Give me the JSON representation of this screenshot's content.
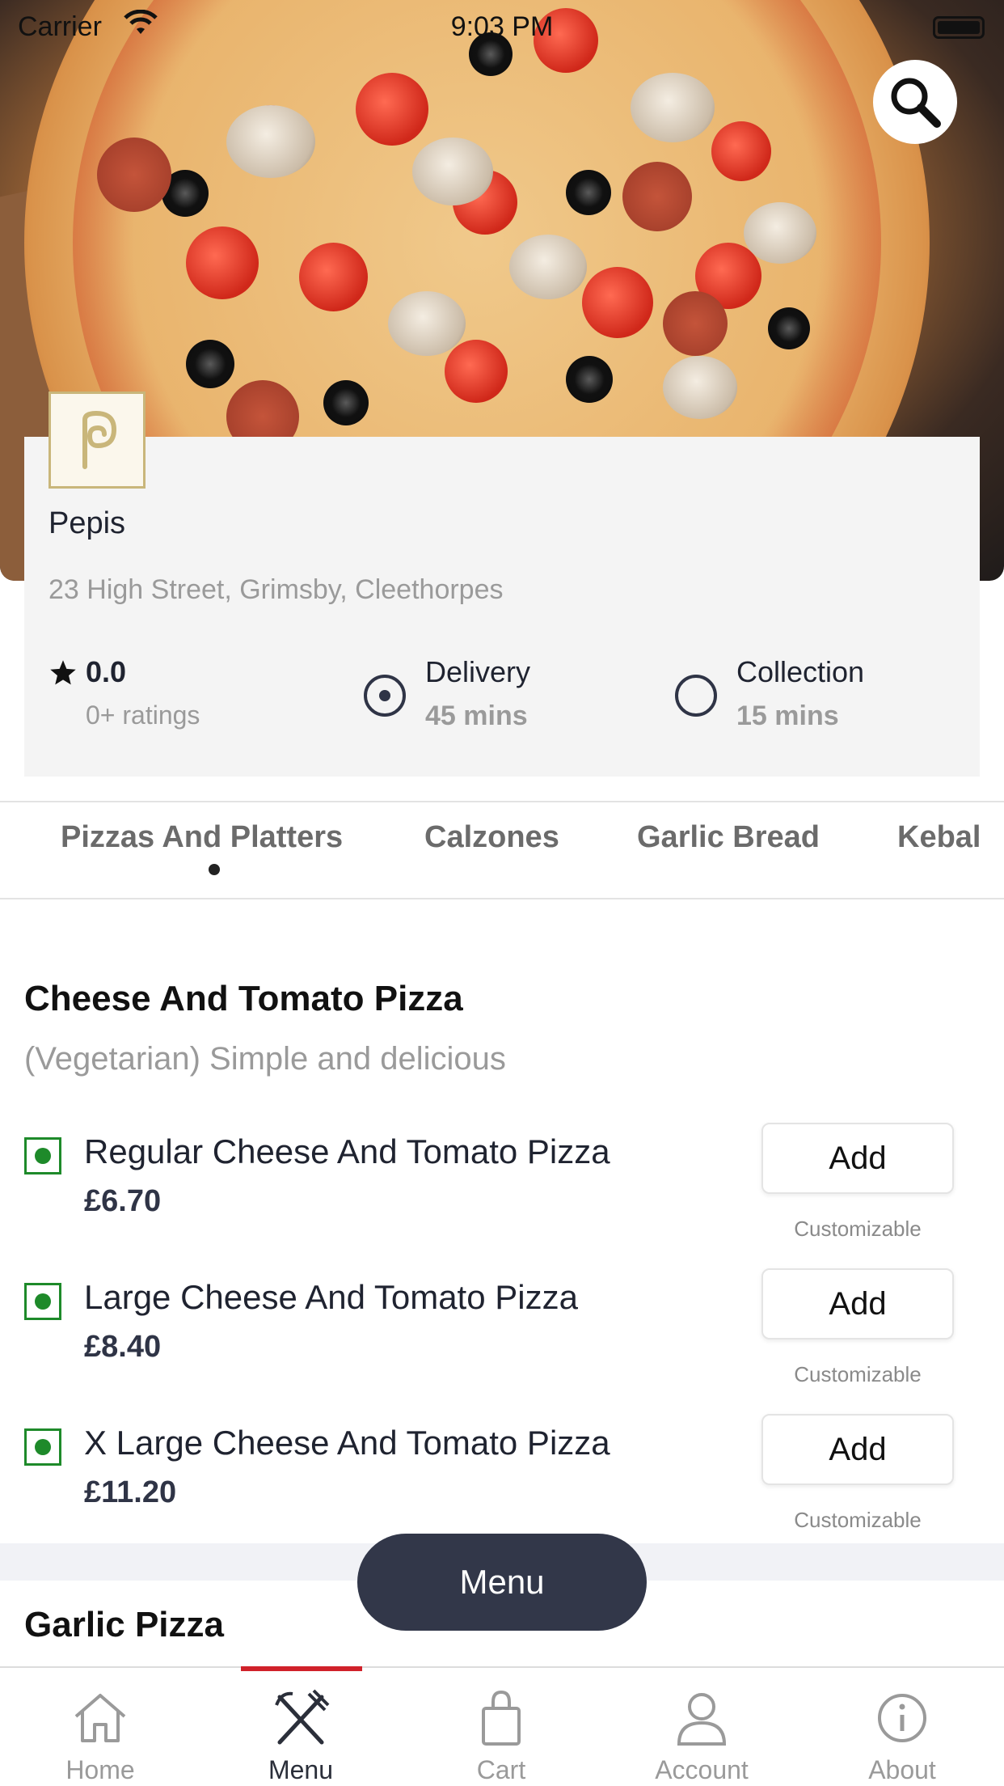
{
  "status_bar": {
    "carrier": "Carrier",
    "time": "9:03 PM"
  },
  "restaurant": {
    "name": "Pepis",
    "address": "23 High Street, Grimsby, Cleethorpes",
    "rating": "0.0",
    "ratings_count": "0+ ratings",
    "options": [
      {
        "label": "Delivery",
        "time": "45 mins",
        "selected": true
      },
      {
        "label": "Collection",
        "time": "15 mins",
        "selected": false
      }
    ]
  },
  "tabs": [
    "Pizzas And Platters",
    "Calzones",
    "Garlic Bread",
    "Kebal"
  ],
  "active_tab": "Pizzas And Platters",
  "section": {
    "title": "Cheese And Tomato Pizza",
    "description": "(Vegetarian) Simple and delicious",
    "items": [
      {
        "name": "Regular Cheese And Tomato Pizza",
        "price": "£6.70",
        "add_label": "Add",
        "note": "Customizable"
      },
      {
        "name": "Large Cheese And Tomato Pizza",
        "price": "£8.40",
        "add_label": "Add",
        "note": "Customizable"
      },
      {
        "name": "X Large Cheese And Tomato Pizza",
        "price": "£11.20",
        "add_label": "Add",
        "note": "Customizable"
      }
    ]
  },
  "next_section": {
    "title": "Garlic Pizza"
  },
  "menu_button": "Menu",
  "bottom_nav": [
    {
      "label": "Home",
      "icon": "home-icon"
    },
    {
      "label": "Menu",
      "icon": "fork-knife-icon",
      "active": true
    },
    {
      "label": "Cart",
      "icon": "shopping-bag-icon"
    },
    {
      "label": "Account",
      "icon": "user-icon"
    },
    {
      "label": "About",
      "icon": "info-icon"
    }
  ],
  "colors": {
    "accent": "#d0212a",
    "dark": "#323749",
    "veg": "#1e8a2a"
  }
}
